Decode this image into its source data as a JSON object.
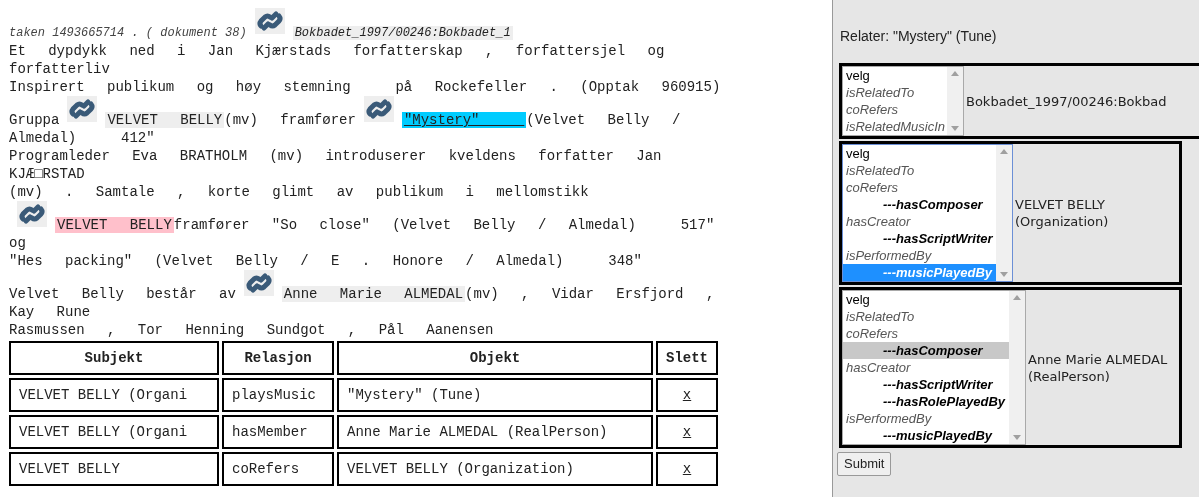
{
  "document": {
    "lines": [
      [
        {
          "kind": "meta",
          "text": "taken 1493665714 . ( dokument 38)"
        },
        {
          "kind": "link_icon"
        },
        {
          "kind": "mention",
          "text": "Bokbadet_1997/00246:Bokbadet_1",
          "color": "#eeeeee",
          "italic": true
        }
      ],
      [
        {
          "kind": "text",
          "text": "Et dypdykk ned i Jan Kjærstads forfatterskap , forfattersjel og"
        }
      ],
      [
        {
          "kind": "text",
          "text": "forfatterliv"
        }
      ],
      [
        {
          "kind": "text",
          "text": "Inspirert publikum og høy stemning  på Rockefeller . (Opptak 960915)"
        }
      ],
      [
        {
          "kind": "text",
          "text": "Gruppa"
        },
        {
          "kind": "link_icon"
        },
        {
          "kind": "mention",
          "text": "VELVET BELLY",
          "color": "#eeeeee"
        },
        {
          "kind": "text",
          "text": "(mv) framfører"
        },
        {
          "kind": "link_icon"
        },
        {
          "kind": "mention",
          "text": "\"Mystery\"  ",
          "color": "#00ccff",
          "underline": true
        },
        {
          "kind": "text",
          "text": "(Velvet Belly /"
        }
      ],
      [
        {
          "kind": "text",
          "text": "Almedal)  412\""
        }
      ],
      [
        {
          "kind": "text",
          "text": "Programleder Eva BRATHOLM (mv) introduserer kveldens forfatter Jan"
        }
      ],
      [
        {
          "kind": "text",
          "text": "KJÆ□RSTAD"
        }
      ],
      [
        {
          "kind": "text",
          "text": "(mv) . Samtale , korte glimt av publikum i mellomstikk"
        }
      ],
      [
        {
          "kind": "link_icon"
        },
        {
          "kind": "mention",
          "text": "VELVET BELLY",
          "color": "#ffc0cb"
        },
        {
          "kind": "text",
          "text": "framfører \"So close\" (Velvet Belly / Almedal)  517\""
        }
      ],
      [
        {
          "kind": "text",
          "text": "og"
        }
      ],
      [
        {
          "kind": "text",
          "text": "\"Hes packing\" (Velvet Belly / E . Honore / Almedal)  348\""
        }
      ],
      [
        {
          "kind": "text",
          "text": "Velvet Belly består av"
        },
        {
          "kind": "link_icon"
        },
        {
          "kind": "mention",
          "text": "Anne Marie ALMEDAL",
          "color": "#eeeeee"
        },
        {
          "kind": "text",
          "text": "(mv) , Vidar Ersfjord ,"
        }
      ],
      [
        {
          "kind": "text",
          "text": "Kay Rune"
        }
      ],
      [
        {
          "kind": "text",
          "text": "Rasmussen , Tor Henning Sundgot , Pål Aanensen"
        }
      ]
    ]
  },
  "table": {
    "columns": [
      "Subjekt",
      "Relasjon",
      "Objekt",
      "Slett"
    ],
    "rows": [
      [
        "VELVET BELLY (Organi",
        "playsMusic",
        "\"Mystery\" (Tune)",
        "x"
      ],
      [
        "VELVET BELLY (Organi",
        "hasMember",
        "Anne Marie ALMEDAL (RealPerson)",
        "x"
      ],
      [
        "VELVET BELLY",
        "coRefers",
        "VELVET BELLY (Organization)",
        "x"
      ]
    ]
  },
  "panel": {
    "title": "Relater: \"Mystery\" (Tune)",
    "relations": [
      {
        "target": "Bokbadet_1997/00246:Bokbad",
        "focused": false,
        "options": [
          {
            "kind": "default",
            "label": "velg",
            "selected": false
          },
          {
            "kind": "relation",
            "label": "isRelatedTo",
            "selected": false
          },
          {
            "kind": "relation",
            "label": "coRefers",
            "selected": false
          },
          {
            "kind": "relation",
            "label": "isRelatedMusicIn",
            "selected": false
          }
        ]
      },
      {
        "target": "VELVET BELLY\n(Organization)",
        "focused": true,
        "options": [
          {
            "kind": "default",
            "label": "velg",
            "selected": false
          },
          {
            "kind": "relation",
            "label": "isRelatedTo",
            "selected": false
          },
          {
            "kind": "relation",
            "label": "coRefers",
            "selected": false
          },
          {
            "kind": "subrelation",
            "label": "---hasComposer",
            "selected": false
          },
          {
            "kind": "relation",
            "label": "hasCreator",
            "selected": false
          },
          {
            "kind": "subrelation",
            "label": "---hasScriptWriter",
            "selected": false
          },
          {
            "kind": "relation",
            "label": "isPerformedBy",
            "selected": false
          },
          {
            "kind": "subrelation",
            "label": "---musicPlayedBy",
            "selected": true
          }
        ]
      },
      {
        "target": "Anne Marie ALMEDAL\n(RealPerson)",
        "focused": false,
        "options": [
          {
            "kind": "default",
            "label": "velg",
            "selected": false
          },
          {
            "kind": "relation",
            "label": "isRelatedTo",
            "selected": false
          },
          {
            "kind": "relation",
            "label": "coRefers",
            "selected": false
          },
          {
            "kind": "subrelation",
            "label": "---hasComposer",
            "selected": true
          },
          {
            "kind": "relation",
            "label": "hasCreator",
            "selected": false
          },
          {
            "kind": "subrelation",
            "label": "---hasScriptWriter",
            "selected": false
          },
          {
            "kind": "subrelation",
            "label": "---hasRolePlayedBy",
            "selected": false
          },
          {
            "kind": "relation",
            "label": "isPerformedBy",
            "selected": false
          },
          {
            "kind": "subrelation",
            "label": "---musicPlayedBy",
            "selected": false
          }
        ]
      }
    ],
    "submit": "Submit"
  }
}
